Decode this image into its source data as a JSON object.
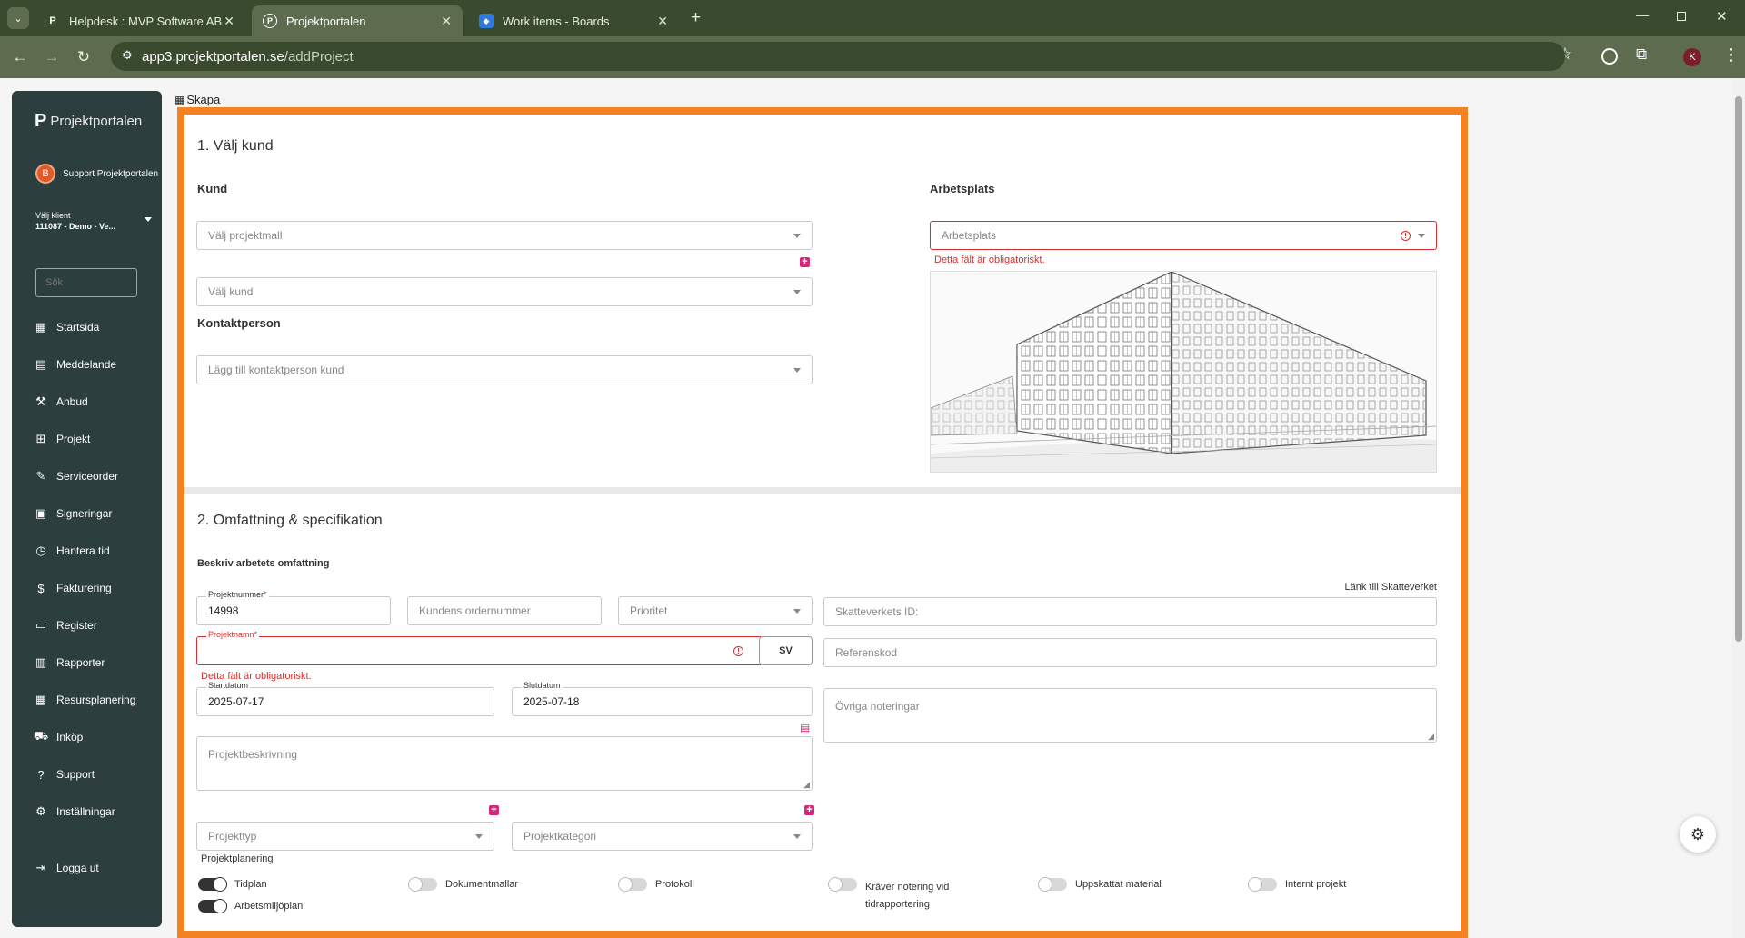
{
  "browser": {
    "tabs": [
      {
        "title": "Helpdesk : MVP Software AB",
        "icon": "P",
        "active": false
      },
      {
        "title": "Projektportalen",
        "icon": "P",
        "active": true
      },
      {
        "title": "Work items - Boards",
        "icon": "azure-devops-icon",
        "active": false
      }
    ],
    "url_host": "app3.projektportalen.se",
    "url_path": "/addProject",
    "profile_initial": "K"
  },
  "sidebar": {
    "brand": "Projektportalen",
    "user": "Support Projektportalen",
    "user_initial": "B",
    "client_label": "Välj klient",
    "client_value": "111087 - Demo - Ve...",
    "search_placeholder": "Sök",
    "items": [
      {
        "label": "Startsida",
        "icon": "dashboard-icon"
      },
      {
        "label": "Meddelande",
        "icon": "message-icon"
      },
      {
        "label": "Anbud",
        "icon": "gavel-icon"
      },
      {
        "label": "Projekt",
        "icon": "grid-icon"
      },
      {
        "label": "Serviceorder",
        "icon": "wrench-icon"
      },
      {
        "label": "Signeringar",
        "icon": "signature-icon"
      },
      {
        "label": "Hantera tid",
        "icon": "clock-icon"
      },
      {
        "label": "Fakturering",
        "icon": "dollar-icon"
      },
      {
        "label": "Register",
        "icon": "register-icon"
      },
      {
        "label": "Rapporter",
        "icon": "report-icon"
      },
      {
        "label": "Resursplanering",
        "icon": "calendar-icon"
      },
      {
        "label": "Inköp",
        "icon": "cart-icon"
      },
      {
        "label": "Support",
        "icon": "help-icon"
      },
      {
        "label": "Inställningar",
        "icon": "gear-icon"
      }
    ],
    "logout": "Logga ut"
  },
  "breadcrumb": "Skapa",
  "section1": {
    "title": "1. Välj kund",
    "kund_heading": "Kund",
    "projektmall_placeholder": "Välj projektmall",
    "kund_placeholder": "Välj kund",
    "kontakt_heading": "Kontaktperson",
    "kontakt_placeholder": "Lägg till kontaktperson kund",
    "arbetsplats_heading": "Arbetsplats",
    "arbetsplats_placeholder": "Arbetsplats",
    "arbetsplats_error": "Detta fält är obligatoriskt."
  },
  "section2": {
    "title": "2. Omfattning & specifikation",
    "subtitle": "Beskriv arbetets omfattning",
    "projektnummer_label": "Projektnummer",
    "projektnummer_value": "14998",
    "ordernummer_placeholder": "Kundens ordernummer",
    "prioritet_placeholder": "Prioritet",
    "skatteverket_link": "Länk till Skatteverket",
    "skatteverket_placeholder": "Skatteverkets ID:",
    "projektnamn_label": "Projektnamn",
    "projektnamn_error": "Detta fält är obligatoriskt.",
    "lang_button": "SV",
    "referenskod_placeholder": "Referenskod",
    "startdatum_label": "Startdatum",
    "startdatum_value": "2025-07-17",
    "slutdatum_label": "Slutdatum",
    "slutdatum_value": "2025-07-18",
    "ovriga_placeholder": "Övriga noteringar",
    "beskrivning_placeholder": "Projektbeskrivning",
    "projekttyp_placeholder": "Projekttyp",
    "projektkategori_placeholder": "Projektkategori",
    "planering_heading": "Projektplanering",
    "toggles": [
      {
        "label": "Tidplan",
        "on": true
      },
      {
        "label": "Dokumentmallar",
        "on": false
      },
      {
        "label": "Protokoll",
        "on": false
      },
      {
        "label": "Kräver notering vid tidrapportering",
        "on": false
      },
      {
        "label": "Uppskattat material",
        "on": false
      },
      {
        "label": "Internt projekt",
        "on": false
      },
      {
        "label": "Arbetsmiljöplan",
        "on": true
      }
    ]
  },
  "colors": {
    "accent_border": "#f58220",
    "sidebar": "#2c3e3d",
    "error": "#d32f2f",
    "plus": "#d6287a"
  }
}
